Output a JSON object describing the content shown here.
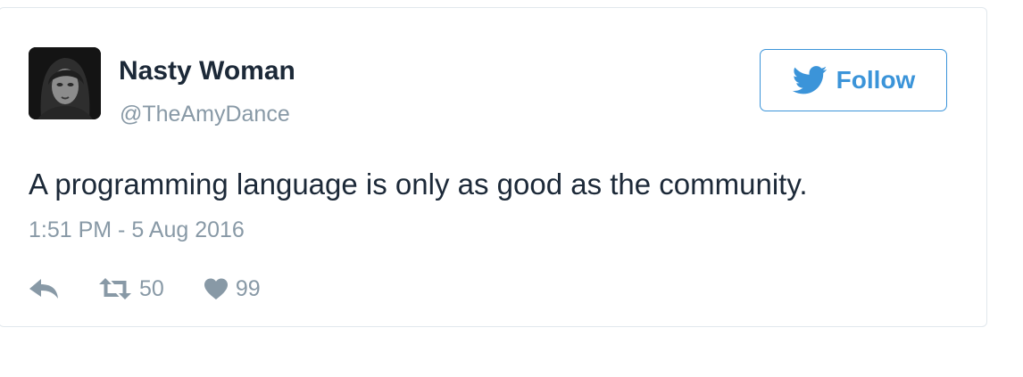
{
  "tweet": {
    "author_name": "Nasty Woman",
    "author_handle": "@TheAmyDance",
    "follow_label": "Follow",
    "text": "A programming language is only as good as the community.",
    "timestamp": "1:51 PM - 5 Aug 2016",
    "retweet_count": "50",
    "like_count": "99"
  },
  "icons": {
    "follow": "twitter-bird-icon",
    "reply": "reply-icon",
    "retweet": "retweet-icon",
    "like": "heart-icon"
  },
  "colors": {
    "accent": "#3b94d9",
    "text": "#1c2938",
    "muted": "#8899a6",
    "border": "#e1e8ed"
  }
}
